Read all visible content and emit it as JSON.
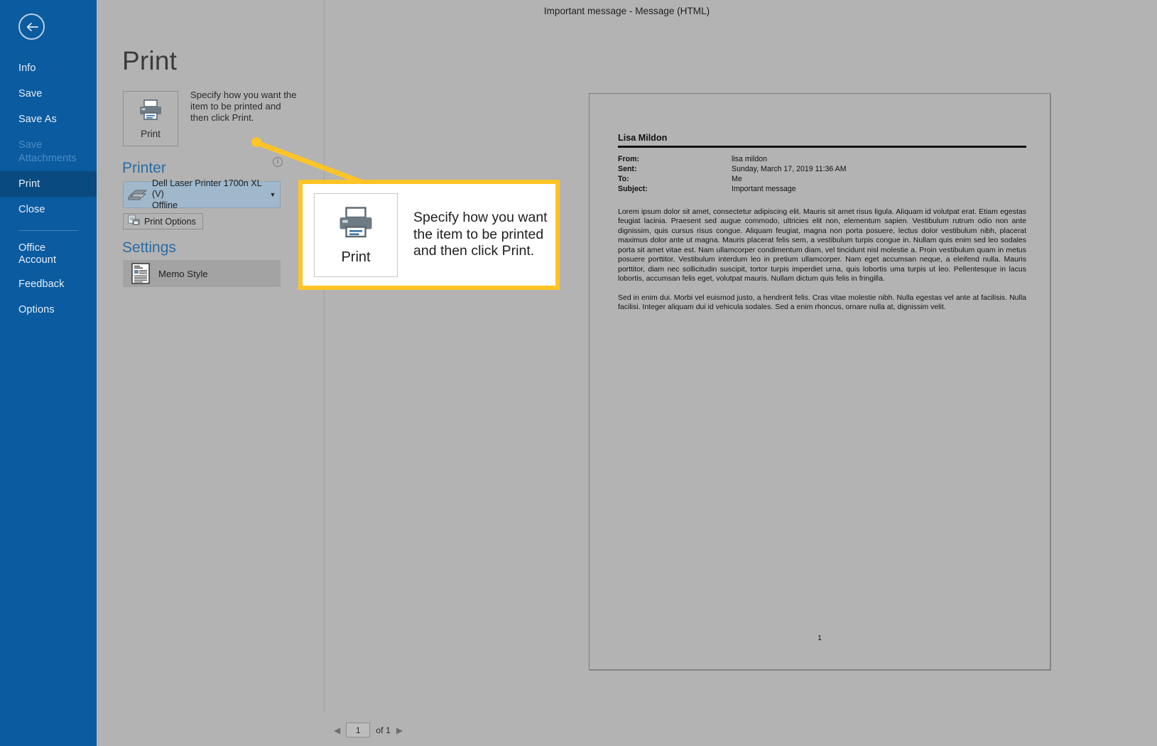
{
  "window": {
    "title": "Important message  -  Message (HTML)"
  },
  "backstage": {
    "back_icon": "back-arrow-icon",
    "items": [
      {
        "label": "Info",
        "state": "normal"
      },
      {
        "label": "Save",
        "state": "normal"
      },
      {
        "label": "Save As",
        "state": "normal"
      },
      {
        "label": "Save Attachments",
        "state": "disabled"
      },
      {
        "label": "Print",
        "state": "active"
      },
      {
        "label": "Close",
        "state": "normal"
      },
      {
        "label": "Office Account",
        "state": "normal"
      },
      {
        "label": "Feedback",
        "state": "normal"
      },
      {
        "label": "Options",
        "state": "normal"
      }
    ]
  },
  "print_pane": {
    "title": "Print",
    "print_button_label": "Print",
    "print_button_icon": "printer-icon",
    "help_text": "Specify how you want the item to be printed and then click Print.",
    "printer_heading": "Printer",
    "info_icon": "info-icon",
    "info_glyph": "i",
    "printer": {
      "name": "Dell Laser Printer 1700n XL (V)",
      "status": "Offline",
      "icon": "printer-device-icon",
      "caret": "▼"
    },
    "print_options_label": "Print Options",
    "print_options_icon": "print-options-icon",
    "settings_heading": "Settings",
    "settings_selected": {
      "label": "Memo Style",
      "icon": "memo-style-icon"
    }
  },
  "pager": {
    "prev_icon": "previous-page-icon",
    "next_icon": "next-page-icon",
    "prev_glyph": "◀",
    "next_glyph": "▶",
    "current_page": "1",
    "of_label": "of 1"
  },
  "preview": {
    "sender_name": "Lisa Mildon",
    "fields": [
      {
        "key": "From:",
        "value": "lisa mildon"
      },
      {
        "key": "Sent:",
        "value": "Sunday, March 17, 2019 11:36 AM"
      },
      {
        "key": "To:",
        "value": "Me"
      },
      {
        "key": "Subject:",
        "value": "Important message"
      }
    ],
    "body_paragraphs": [
      "Lorem ipsum dolor sit amet, consectetur adipiscing elit. Mauris sit amet risus ligula. Aliquam id volutpat erat. Etiam egestas feugiat lacinia. Praesent sed augue commodo, ultricies elit non, elementum sapien. Vestibulum rutrum odio non ante dignissim, quis cursus risus congue. Aliquam feugiat, magna non porta posuere, lectus dolor vestibulum nibh, placerat maximus dolor ante ut magna. Mauris placerat felis sem, a vestibulum turpis congue in. Nullam quis enim sed leo sodales porta sit amet vitae est. Nam ullamcorper condimentum diam, vel tincidunt nisl molestie a. Proin vestibulum quam in metus posuere porttitor. Vestibulum interdum leo in pretium ullamcorper. Nam eget accumsan neque, a eleifend nulla. Mauris porttitor, diam nec sollicitudin suscipit, tortor turpis imperdiet urna, quis lobortis uma turpis ut leo. Pellentesque in lacus lobortis, accumsan felis eget, volutpat mauris. Nullam dictum quis felis in fringilla.",
      "Sed in enim dui. Morbi vel euismod justo, a hendrerit felis. Cras vitae molestie nibh. Nulla egestas vel ante at facilisis. Nulla facilisi. Integer aliquam dui id vehicula sodales. Sed a enim rhoncus, ornare nulla at, dignissim velit."
    ],
    "page_number": "1"
  },
  "callout": {
    "button_label": "Print",
    "button_icon": "printer-icon",
    "text": "Specify how you want the item to be printed and then click Print.",
    "accent_color": "#ffc425"
  }
}
